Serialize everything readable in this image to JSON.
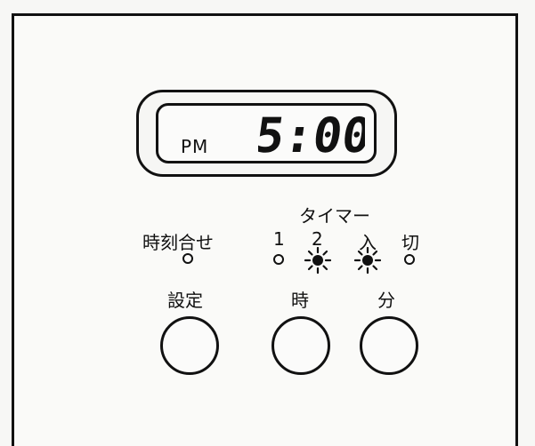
{
  "display": {
    "ampm": "PM",
    "time": "5:00"
  },
  "clock_set": {
    "label": "時刻合せ",
    "lamp_state": "off"
  },
  "timer": {
    "label": "タイマー",
    "modes": [
      {
        "label": "1",
        "lamp_state": "off"
      },
      {
        "label": "2",
        "lamp_state": "on"
      },
      {
        "label": "入",
        "lamp_state": "on"
      },
      {
        "label": "切",
        "lamp_state": "off"
      }
    ]
  },
  "buttons": {
    "set_label": "設定",
    "hour_label": "時",
    "minute_label": "分"
  }
}
